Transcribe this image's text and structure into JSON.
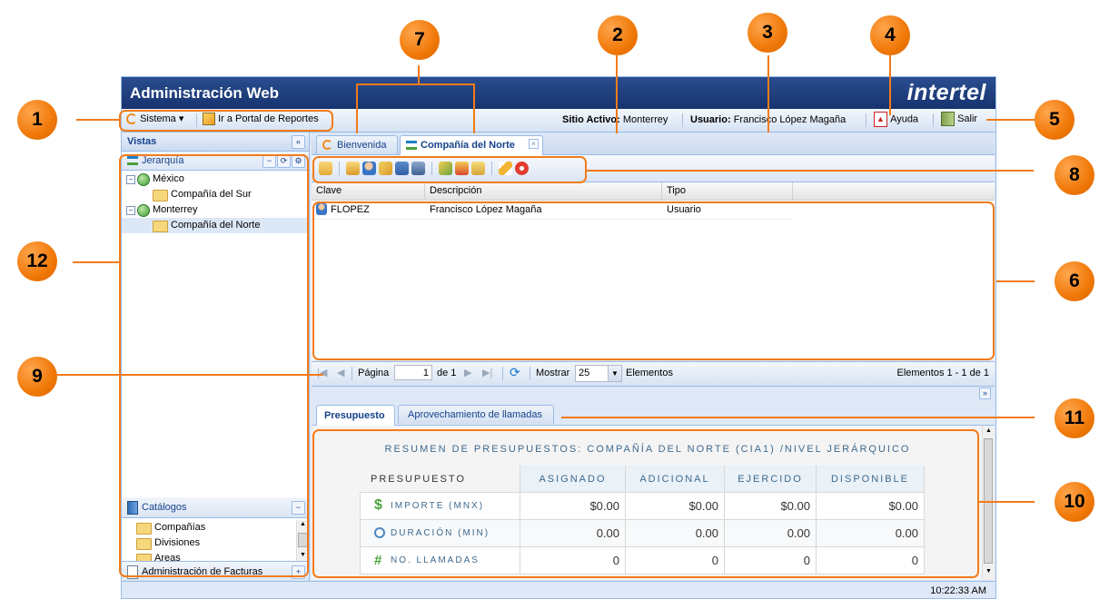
{
  "app": {
    "title": "Administración Web",
    "brand": "intertel"
  },
  "topbar": {
    "sistema_label": "Sistema ▾",
    "portal_label": "Ir a Portal de Reportes",
    "site_label": "Sitio Activo:",
    "site_value": "Monterrey",
    "user_label": "Usuario:",
    "user_value": "Francisco López Magaña",
    "help_label": "Ayuda",
    "exit_label": "Salir"
  },
  "left": {
    "header": "Vistas",
    "collapse_glyph": "«",
    "hierarchy_title": "Jerarquía",
    "tree": [
      {
        "label": "México",
        "level": 0,
        "type": "globe"
      },
      {
        "label": "Compañía del Sur",
        "level": 1,
        "type": "folder"
      },
      {
        "label": "Monterrey",
        "level": 0,
        "type": "globe"
      },
      {
        "label": "Compañía del Norte",
        "level": 1,
        "type": "folder",
        "selected": true
      }
    ],
    "catalogs_title": "Catálogos",
    "catalogs": [
      "Compañías",
      "Divisiones",
      "Areas"
    ],
    "invoices_title": "Administración de Facturas"
  },
  "tabs": {
    "welcome": "Bienvenida",
    "company": "Compañía del Norte"
  },
  "grid": {
    "columns": [
      "Clave",
      "Descripción",
      "Tipo"
    ],
    "rows": [
      {
        "clave": "FLOPEZ",
        "descripcion": "Francisco López Magaña",
        "tipo": "Usuario"
      }
    ]
  },
  "pager": {
    "page_label": "Página",
    "page_value": "1",
    "of_label": "de 1",
    "show_label": "Mostrar",
    "show_value": "25",
    "items_label": "Elementos",
    "range_label": "Elementos 1 - 1 de 1"
  },
  "bottom_tabs": {
    "budget": "Presupuesto",
    "calls": "Aprovechamiento de llamadas"
  },
  "summary": {
    "title": "RESUMEN DE PRESUPUESTOS: COMPAÑÍA DEL NORTE (CIA1) /NIVEL JERÁRQUICO",
    "col_label": "PRESUPUESTO",
    "headers": [
      "ASIGNADO",
      "ADICIONAL",
      "EJERCIDO",
      "DISPONIBLE"
    ],
    "rows": [
      {
        "label": "IMPORTE (MNX)",
        "icon": "$",
        "values": [
          "$0.00",
          "$0.00",
          "$0.00",
          "$0.00"
        ]
      },
      {
        "label": "DURACIÓN (MIN)",
        "icon": "clock",
        "values": [
          "0.00",
          "0.00",
          "0.00",
          "0.00"
        ]
      },
      {
        "label": "NO. LLAMADAS",
        "icon": "#",
        "values": [
          "0",
          "0",
          "0",
          "0"
        ]
      }
    ]
  },
  "status": {
    "clock": "10:22:33 AM"
  },
  "callouts": [
    "1",
    "2",
    "3",
    "4",
    "5",
    "6",
    "7",
    "8",
    "9",
    "10",
    "11",
    "12"
  ],
  "colors": {
    "accent": "#f37b1a",
    "header_blue": "#16336e",
    "panel_border": "#99bbe8"
  }
}
